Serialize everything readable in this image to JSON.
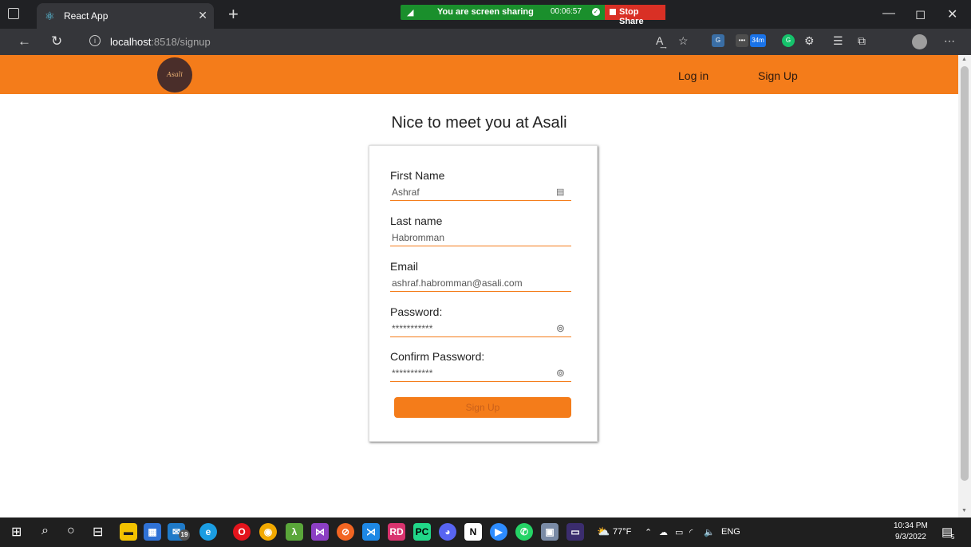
{
  "browser": {
    "tab_title": "React App",
    "url_host": "localhost",
    "url_path": ":8518/signup",
    "read_aloud": "A͢",
    "ext_badge_34m": "34m"
  },
  "screen_share": {
    "text": "You are screen sharing",
    "time": "00:06:57",
    "stop_label": "Stop Share"
  },
  "header": {
    "logo_text": "Asali",
    "nav": [
      {
        "label": "Log in"
      },
      {
        "label": "Sign Up"
      }
    ]
  },
  "page": {
    "title": "Nice to meet you at Asali"
  },
  "form": {
    "fields": [
      {
        "label": "First Name",
        "value": "Ashraf"
      },
      {
        "label": "Last name",
        "value": "Habromman"
      },
      {
        "label": "Email",
        "value": "ashraf.habromman@asali.com"
      },
      {
        "label": "Password:",
        "value": "***********"
      },
      {
        "label": "Confirm Password:",
        "value": "***********"
      }
    ],
    "submit_label": "Sign Up"
  },
  "taskbar": {
    "weather": "77°F",
    "language": "ENG",
    "time": "10:34 PM",
    "date": "9/3/2022",
    "mail_badge": "19",
    "notif_badge": "5"
  },
  "colors": {
    "accent": "#f47c1a",
    "logo_bg": "#4a2e2a",
    "share_green": "#1a8f2c",
    "stop_red": "#d93025"
  }
}
